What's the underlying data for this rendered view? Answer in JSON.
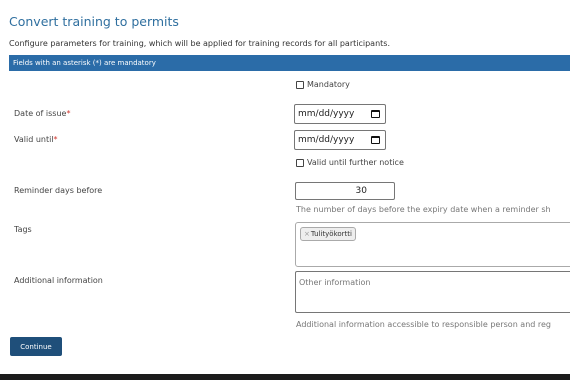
{
  "header": {
    "title": "Convert training to permits",
    "subtitle": "Configure parameters for training, which will be applied for training records for all participants."
  },
  "banner": {
    "text": "Fields with an asterisk (*) are mandatory"
  },
  "form": {
    "mandatory_label": "Mandatory",
    "mandatory_checked": false,
    "date_of_issue": {
      "label": "Date of issue",
      "asterisk": "*",
      "placeholder": "mm/dd/yyyy"
    },
    "valid_until": {
      "label": "Valid until",
      "asterisk": "*",
      "placeholder": "mm/dd/yyyy"
    },
    "valid_until_further_notice_label": "Valid until further notice",
    "valid_until_further_notice_checked": false,
    "reminder": {
      "label": "Reminder days before",
      "value": "30",
      "help": "The number of days before the expiry date when a reminder sh"
    },
    "tags": {
      "label": "Tags",
      "items": [
        {
          "remove": "×",
          "text": "Tulityökortti"
        }
      ]
    },
    "additional_info": {
      "label": "Additional information",
      "placeholder": "Other information",
      "help": "Additional information accessible to responsible person and reg"
    }
  },
  "actions": {
    "continue_label": "Continue"
  }
}
